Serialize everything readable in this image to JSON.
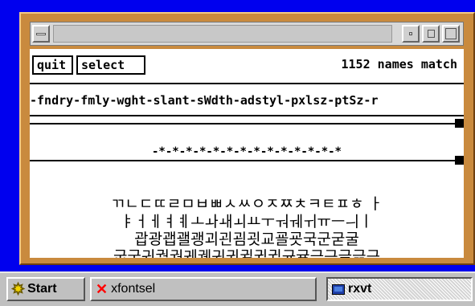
{
  "window": {
    "title": ""
  },
  "toolbar": {
    "quit_label": "quit",
    "select_label": "select",
    "match_text": "1152 names match"
  },
  "pattern": "-fndry-fmly-wght-slant-sWdth-adstyl-pxlsz-ptSz-r",
  "field_values": "-*-*-*-*-*-*-*-*-*-*-*-*-*-*",
  "sample_text": {
    "line1": "ㄲㄴㄷㄸㄹㅁㅂㅃㅅㅆㅇㅈㅉㅊㅋㅌㅍㅎ ㅏ",
    "line2": "ㅑㅓㅔㅕㅖㅗㅘㅙㅚㅛㅜㅝㅞㅟㅠㅡㅢㅣ",
    "line3": "괍광괩괠괭괴괸굄굇교굘굣국군굳굴",
    "line4": "굽굿궈궐궝궤궸귀귄귈귐귑균귤극근글긁긋"
  },
  "taskbar": {
    "start_label": "Start",
    "xfontsel_label": "xfontsel",
    "rxvt_label": "rxvt"
  },
  "colors": {
    "desktop": "#0000ee",
    "frame": "#c98a3e",
    "taskbar": "#c0c0c0"
  },
  "icons": {
    "start": "star-icon",
    "xfontsel": "x-icon",
    "rxvt": "terminal-icon"
  }
}
